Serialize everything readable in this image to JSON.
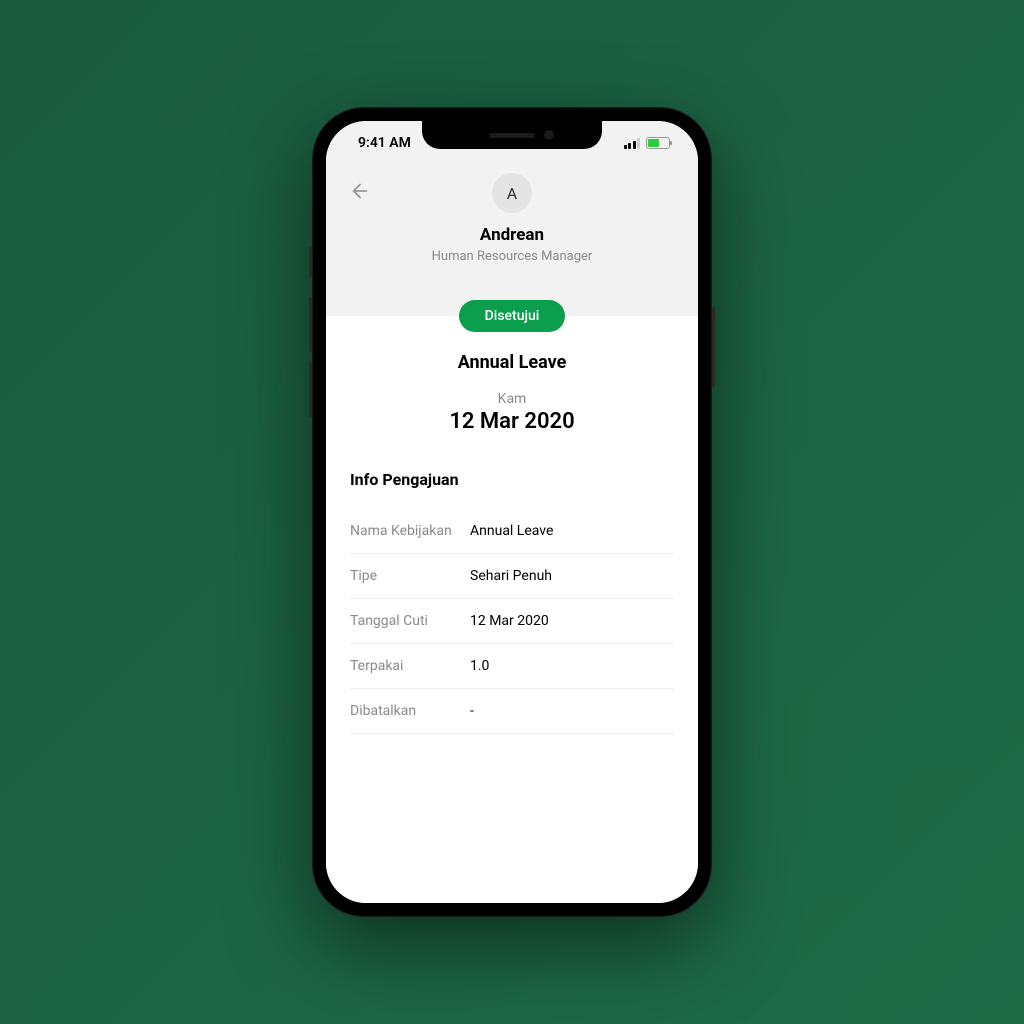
{
  "status_bar": {
    "time": "9:41 AM"
  },
  "profile": {
    "avatar_initial": "A",
    "name": "Andrean",
    "role": "Human Resources Manager"
  },
  "status_badge": "Disetujui",
  "leave": {
    "title": "Annual Leave",
    "day_short": "Kam",
    "date": "12 Mar 2020"
  },
  "info": {
    "heading": "Info Pengajuan",
    "rows": [
      {
        "label": "Nama Kebijakan",
        "value": "Annual Leave"
      },
      {
        "label": "Tipe",
        "value": "Sehari Penuh"
      },
      {
        "label": "Tanggal Cuti",
        "value": "12 Mar 2020"
      },
      {
        "label": "Terpakai",
        "value": "1.0"
      },
      {
        "label": "Dibatalkan",
        "value": "-"
      }
    ]
  }
}
